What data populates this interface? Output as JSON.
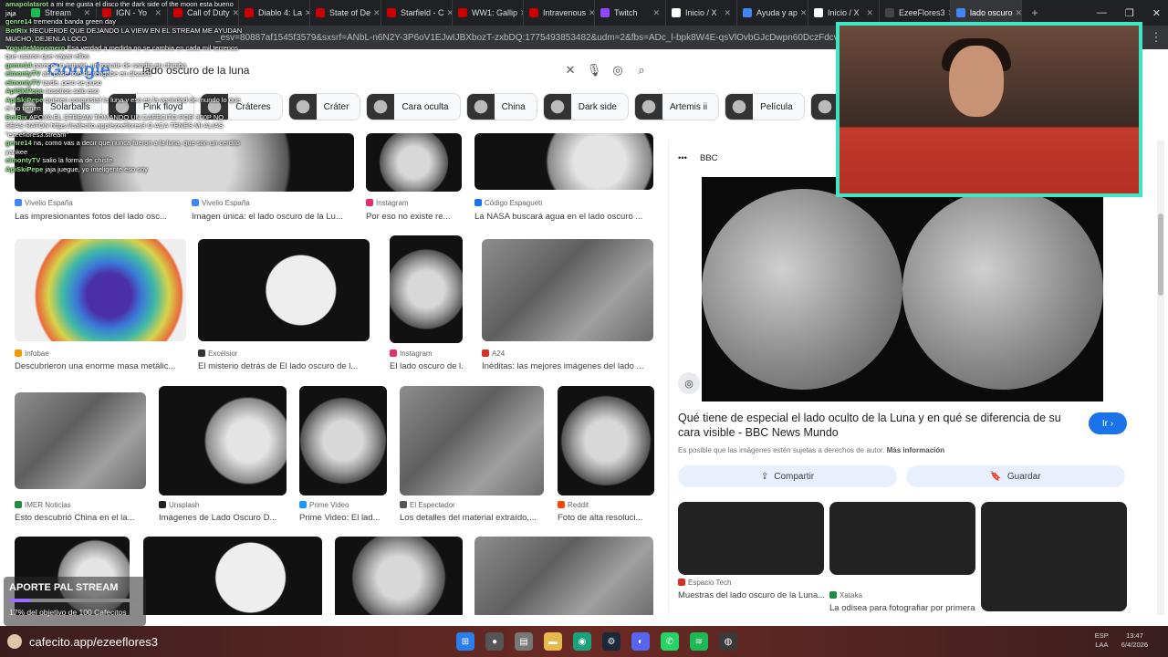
{
  "browser": {
    "tabs": [
      {
        "label": "Stream",
        "color": "#1db954"
      },
      {
        "label": "IGN - Yo",
        "color": "#cc0000"
      },
      {
        "label": "Call of Duty",
        "color": "#cc0000"
      },
      {
        "label": "Diablo 4: La",
        "color": "#cc0000"
      },
      {
        "label": "State of De",
        "color": "#cc0000"
      },
      {
        "label": "Starfield - C",
        "color": "#cc0000"
      },
      {
        "label": "WW1: Gallip",
        "color": "#cc0000"
      },
      {
        "label": "Intravenous",
        "color": "#cc0000"
      },
      {
        "label": "Twitch",
        "color": "#9146ff"
      },
      {
        "label": "Inicio / X",
        "color": "#ffffff"
      },
      {
        "label": "Ayuda y ap",
        "color": "#4285f4"
      },
      {
        "label": "Inicio / X",
        "color": "#ffffff"
      },
      {
        "label": "EzeeFlores3",
        "color": "#444444"
      },
      {
        "label": "lado oscuro",
        "color": "#4285f4"
      }
    ],
    "url": "_esv=80887af1545f3579&sxsrf=ANbL-n6N2Y-3P6oV1EJwIJBXbozT-zxbDQ:1775493853482&udm=2&fbs=ADc_l-bpk8W4E-qsVlOvbGJcDwpn60DczFdcvPnuv8WQo"
  },
  "google": {
    "logo": "Google",
    "query": "lado oscuro de la luna",
    "chips": [
      "Solarballs",
      "Pink floyd",
      "Cráteres",
      "Cráter",
      "Cara oculta",
      "China",
      "Dark side",
      "Artemis ii",
      "Película",
      "Astr"
    ]
  },
  "results": [
    {
      "source": "Vivelio España",
      "caption": "Las impresionantes fotos del lado osc...",
      "color": "#4285f4"
    },
    {
      "source": "Vivelio España",
      "caption": "Imagen única: el lado oscuro de la Lu...",
      "color": "#4285f4"
    },
    {
      "source": "Instagram",
      "caption": "Por eso no existe re...",
      "color": "#e1306c"
    },
    {
      "source": "Código Espagueti",
      "caption": "La NASA buscará agua en el lado oscuro ...",
      "color": "#1a73e8"
    },
    {
      "source": "Infobae",
      "caption": "Descubrieron una enorme masa metálic...",
      "color": "#f29900"
    },
    {
      "source": "Excélsior",
      "caption": "El misterio detrás de El lado oscuro de l...",
      "color": "#333333"
    },
    {
      "source": "Instagram",
      "caption": "El lado oscuro de l...",
      "color": "#e1306c"
    },
    {
      "source": "A24",
      "caption": "Inéditas: las mejores imágenes del lado ...",
      "color": "#d93025"
    },
    {
      "source": "IMER Noticias",
      "caption": "Esto descubrió China en el la...",
      "color": "#1e8e3e"
    },
    {
      "source": "Unsplash",
      "caption": "Imágenes de Lado Oscuro D...",
      "color": "#222222"
    },
    {
      "source": "Prime Video",
      "caption": "Prime Video: El lad...",
      "color": "#1a98ff"
    },
    {
      "source": "El Espectador",
      "caption": "Los detalles del material extraído,...",
      "color": "#555555"
    },
    {
      "source": "Reddit",
      "caption": "Foto de alta resoluci...",
      "color": "#ff4500"
    }
  ],
  "panel": {
    "site": "BBC",
    "title": "Qué tiene de especial el lado oculto de la Luna y en qué se diferencia de su cara visible - BBC News Mundo",
    "go": "Ir",
    "rights": "Es posible que las imágenes estén sujetas a derechos de autor.",
    "more": "Más información",
    "share": "Compartir",
    "save": "Guardar",
    "related": [
      {
        "source": "Espacio Tech",
        "caption": "Muestras del lado oscuro de la Luna...",
        "color": "#d93025"
      },
      {
        "source": "Xataka",
        "caption": "La odisea para fotografiar por primera...",
        "color": "#1e8e3e"
      }
    ]
  },
  "chat": [
    {
      "user": "amapolatarot",
      "text": "a mi me gusta el disco the dark side of the moon esta bueno jaja"
    },
    {
      "user": "genre14",
      "text": "tremenda banda green day"
    },
    {
      "user": "BotRix",
      "text": "RECUERDE QUE DEJANDO LA VIEW EN EL STREAM ME AYUDAN MUCHO, DEJENLA LOCO"
    },
    {
      "user": "YoguiteMonomero",
      "text": "Esa verdad a medida no se cambia en cada mil terrenos que usaron que vayan ellos"
    },
    {
      "user": "genre14",
      "text": "parece un tomate, un tomate de sandia en chimba"
    },
    {
      "user": "elmontyTV",
      "text": "ahi pase foto de tengabe en discord"
    },
    {
      "user": "elmontyTV",
      "text": "tarde, pero se puso"
    },
    {
      "user": "ApiSkiPepe",
      "text": "nosotros solo eso"
    },
    {
      "user": "ApiSkiPepe",
      "text": "quieren conquistar la luna y eso es la vecindad de mundo lo que el no tienen"
    },
    {
      "user": "BotRix",
      "text": "APOYA EL STREAM TOMANDO UN CAFECITO POR 300P NO SEAS RATON https://cafecito.app/ezeeflores3 O ACA TENES MI ALIAS \"ezeeflores3.stream\""
    },
    {
      "user": "genre14",
      "text": "na, como vas a decir que nunca fueron a la luna, que son un cerdito yankee"
    },
    {
      "user": "elmontyTV",
      "text": "salio la forma de chiste"
    },
    {
      "user": "ApiSkiPepe",
      "text": "jaja juegue, yo inteligente eso soy"
    }
  ],
  "aporte": {
    "title": "APORTE PAL STREAM",
    "subtitle": "17% del objetivo de 100 Cafecitos",
    "progress": 0.17
  },
  "taskbar": {
    "cafecito": "cafecito.app/ezeeflores3",
    "lang": "ESP",
    "lang2": "LAA",
    "time": "13:47",
    "date": "6/4/2026"
  }
}
